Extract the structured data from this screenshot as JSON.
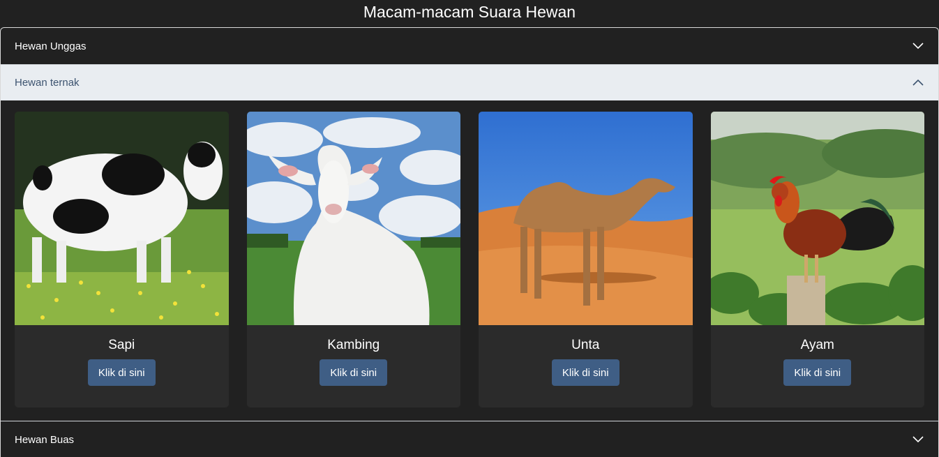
{
  "page": {
    "title": "Macam-macam Suara Hewan"
  },
  "accordion": {
    "sections": [
      {
        "label": "Hewan Unggas",
        "expanded": false
      },
      {
        "label": "Hewan ternak",
        "expanded": true
      },
      {
        "label": "Hewan Buas",
        "expanded": false
      }
    ]
  },
  "cards": [
    {
      "title": "Sapi",
      "button": "Klik di sini",
      "image": "cow-photo"
    },
    {
      "title": "Kambing",
      "button": "Klik di sini",
      "image": "goat-photo"
    },
    {
      "title": "Unta",
      "button": "Klik di sini",
      "image": "camel-photo"
    },
    {
      "title": "Ayam",
      "button": "Klik di sini",
      "image": "rooster-photo"
    }
  ],
  "colors": {
    "background": "#212121",
    "card": "#2b2b2b",
    "button": "#3f5e85",
    "expanded_header_bg": "#e9edf1",
    "expanded_header_text": "#3d5470"
  }
}
